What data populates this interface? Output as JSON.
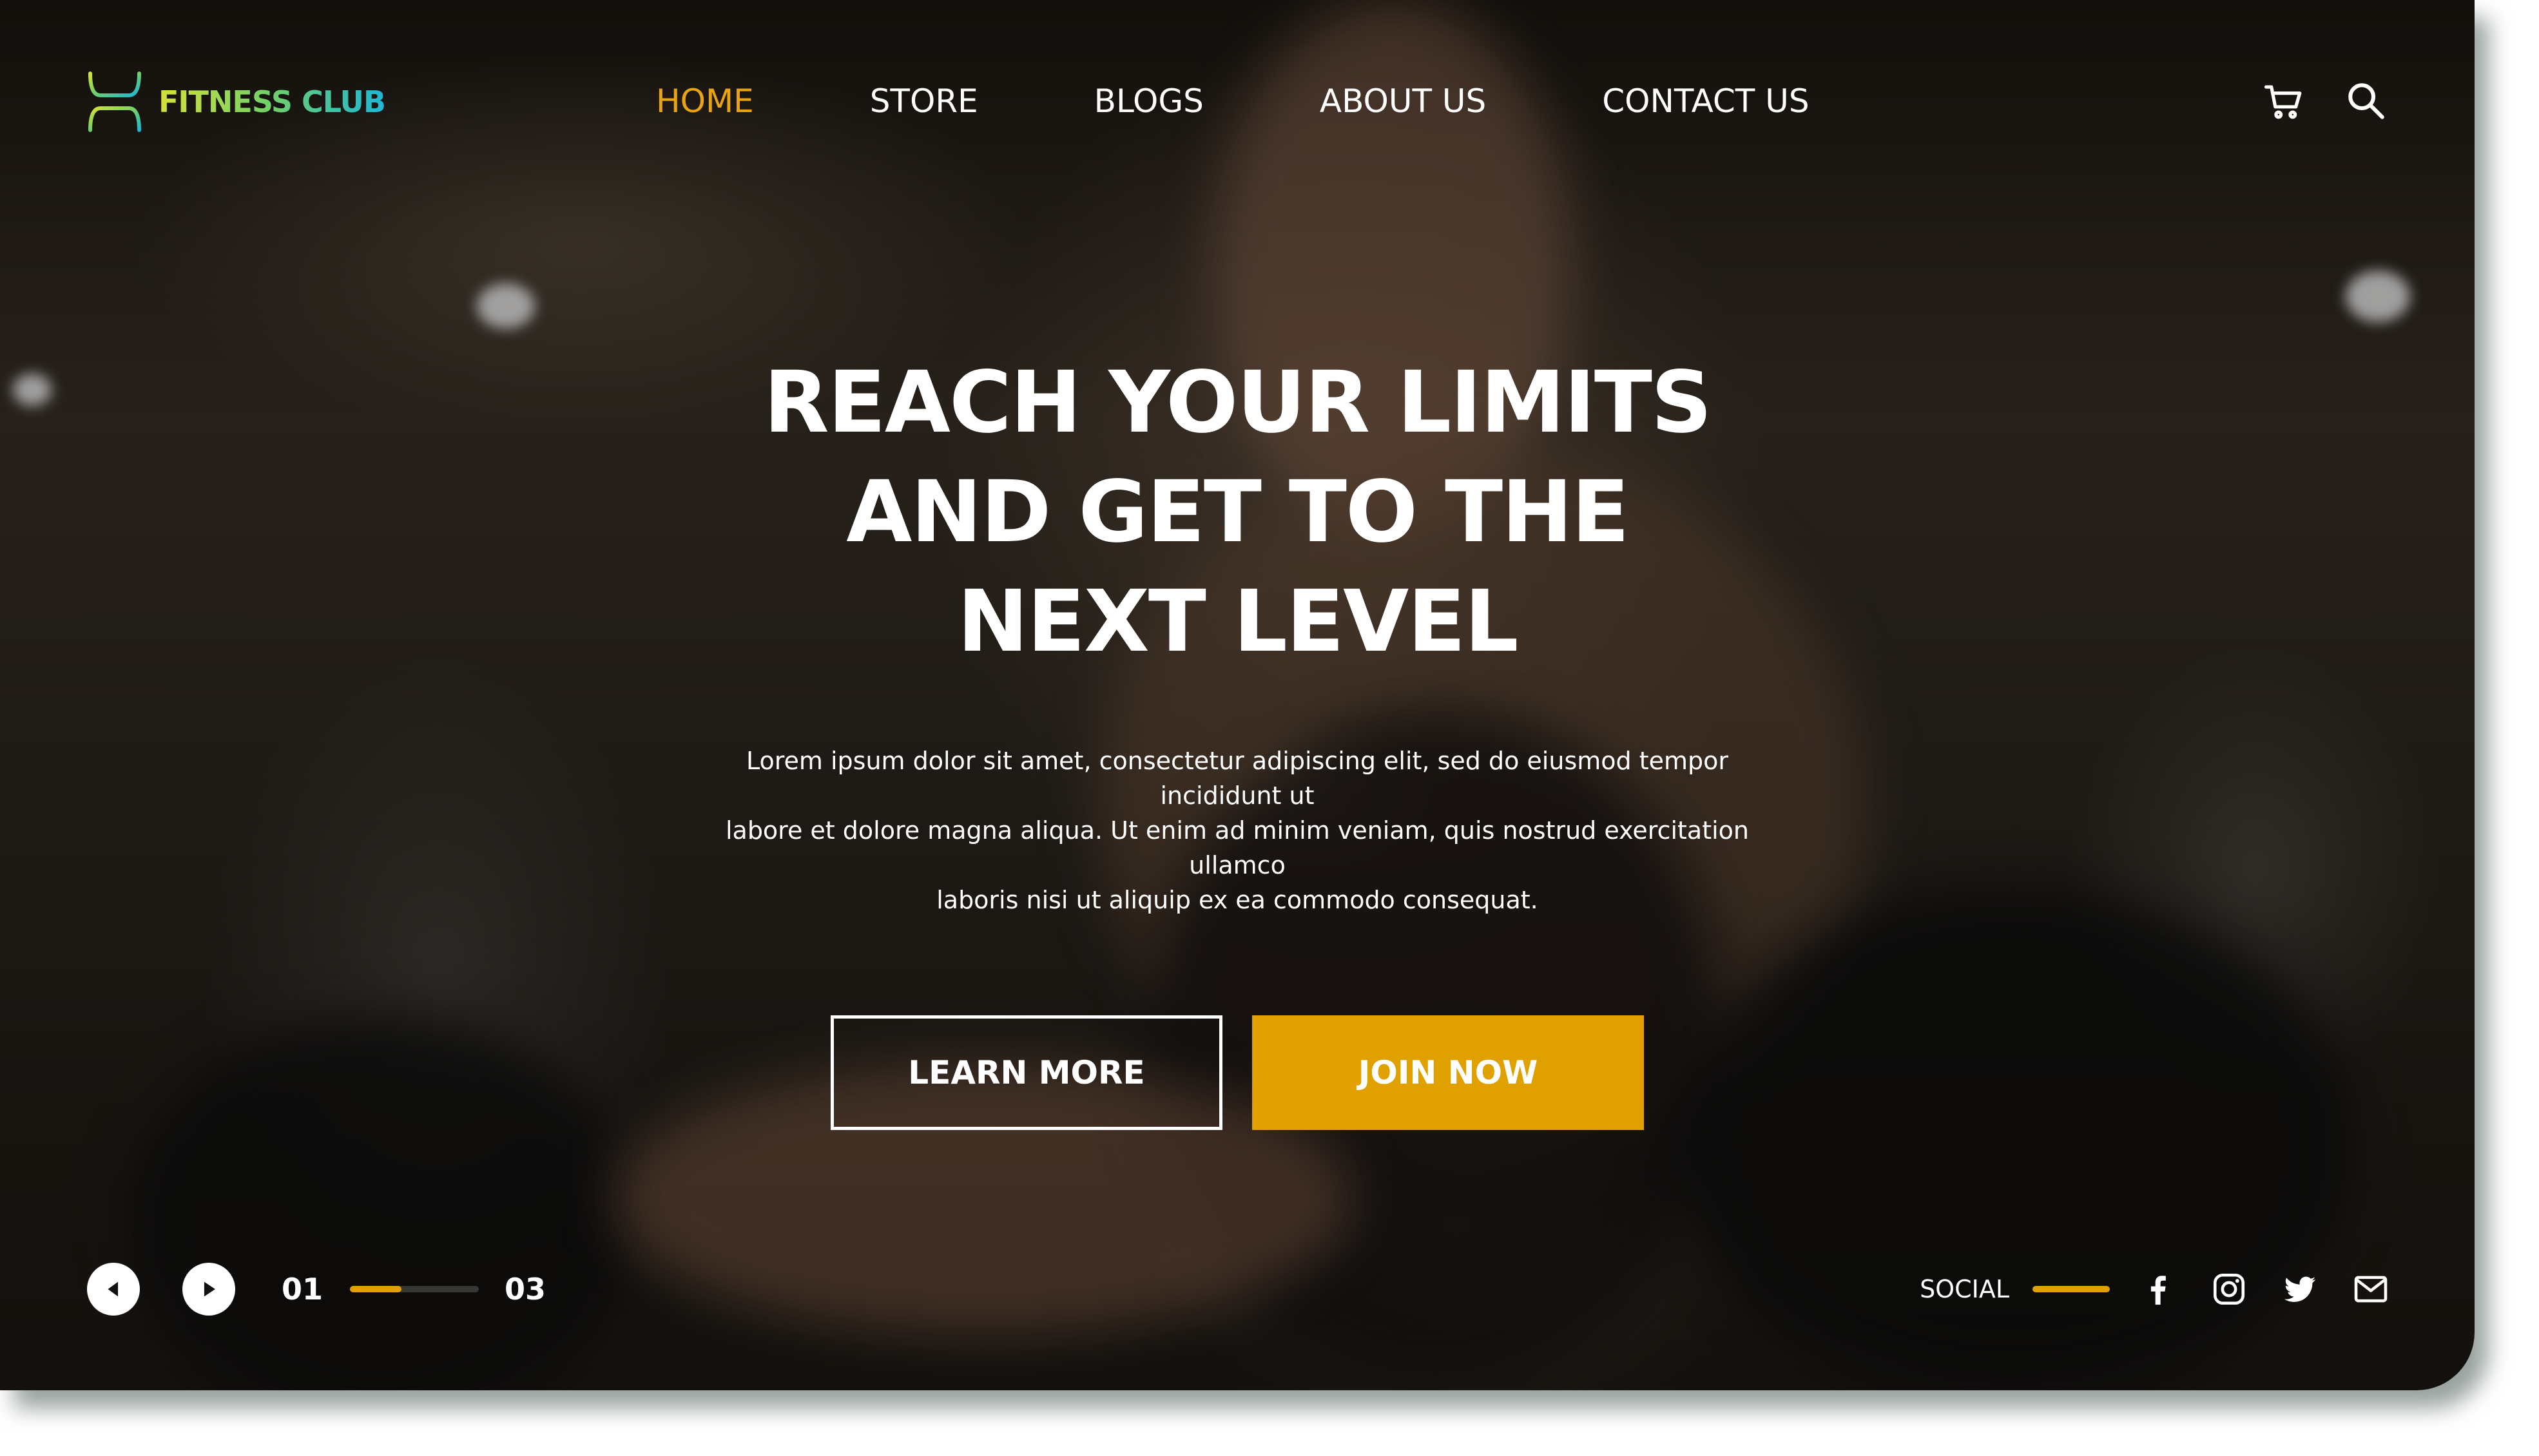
{
  "brand": {
    "name": "FITNESS CLUB",
    "logo_icon": "dumbbell-frame-icon",
    "gradient_colors": [
      "#d6e23a",
      "#6fcf6a",
      "#1fb6d6"
    ]
  },
  "nav": {
    "items": [
      {
        "label": "HOME",
        "active": true
      },
      {
        "label": "STORE",
        "active": false
      },
      {
        "label": "BLOGS",
        "active": false
      },
      {
        "label": "ABOUT US",
        "active": false
      },
      {
        "label": "CONTACT US",
        "active": false
      }
    ],
    "active_color": "#e8a412"
  },
  "header_icons": [
    "cart-icon",
    "search-icon"
  ],
  "hero": {
    "headline_lines": [
      "REACH YOUR LIMITS",
      "AND GET TO THE",
      "NEXT LEVEL"
    ],
    "subtext_lines": [
      "Lorem ipsum dolor sit amet, consectetur adipiscing elit, sed do eiusmod tempor incididunt ut",
      "labore et dolore magna aliqua. Ut enim ad minim veniam, quis nostrud exercitation ullamco",
      "laboris nisi ut aliquip ex ea commodo consequat."
    ],
    "learn_more_label": "LEARN MORE",
    "join_now_label": "JOIN NOW",
    "accent_color": "#e0a100"
  },
  "slider": {
    "current": "01",
    "total": "03",
    "progress_fraction": 0.4,
    "controls": [
      "prev-icon",
      "play-icon"
    ]
  },
  "social": {
    "label": "SOCIAL",
    "icons": [
      "facebook-icon",
      "instagram-icon",
      "twitter-icon",
      "mail-icon"
    ]
  }
}
